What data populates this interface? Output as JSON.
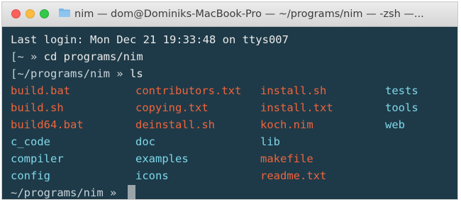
{
  "colors": {
    "terminal_bg": "#1e3a48",
    "text": "#eaeaea",
    "file": "#f0643c",
    "directory": "#7ed8ea",
    "cursor": "#9aa5ab"
  },
  "window": {
    "title": "nim — dom@Dominiks-MacBook-Pro — ~/programs/nim — -zsh —...",
    "folder_icon": "folder-icon"
  },
  "terminal": {
    "last_login": "Last login: Mon Dec 21 19:33:48 on ttys007",
    "prompt1": "[~ » ",
    "cmd1": "cd programs/nim",
    "prompt2": "[~/programs/nim » ",
    "cmd2": "ls",
    "prompt3": "~/programs/nim » "
  },
  "ls_output": [
    {
      "name": "build.bat",
      "type": "file"
    },
    {
      "name": "build.sh",
      "type": "file"
    },
    {
      "name": "build64.bat",
      "type": "file"
    },
    {
      "name": "c_code",
      "type": "dir"
    },
    {
      "name": "compiler",
      "type": "dir"
    },
    {
      "name": "config",
      "type": "dir"
    },
    {
      "name": "contributors.txt",
      "type": "file"
    },
    {
      "name": "copying.txt",
      "type": "file"
    },
    {
      "name": "deinstall.sh",
      "type": "file"
    },
    {
      "name": "doc",
      "type": "dir"
    },
    {
      "name": "examples",
      "type": "dir"
    },
    {
      "name": "icons",
      "type": "dir"
    },
    {
      "name": "install.sh",
      "type": "file"
    },
    {
      "name": "install.txt",
      "type": "file"
    },
    {
      "name": "koch.nim",
      "type": "file"
    },
    {
      "name": "lib",
      "type": "dir"
    },
    {
      "name": "makefile",
      "type": "file"
    },
    {
      "name": "readme.txt",
      "type": "file"
    },
    {
      "name": "tests",
      "type": "dir"
    },
    {
      "name": "tools",
      "type": "dir"
    },
    {
      "name": "web",
      "type": "dir"
    }
  ]
}
